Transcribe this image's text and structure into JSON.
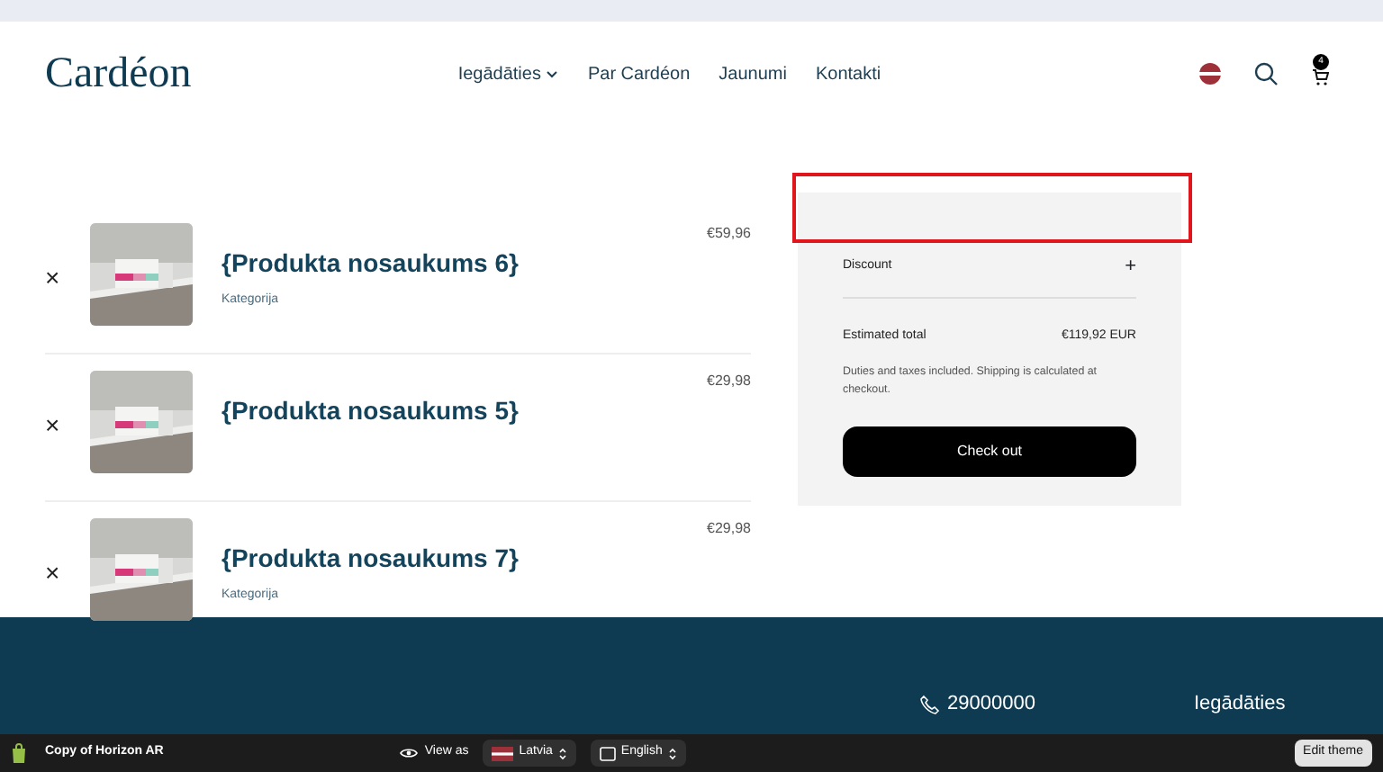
{
  "header": {
    "logo": "Cardéon",
    "nav": [
      {
        "label": "Iegādāties",
        "dropdown": true
      },
      {
        "label": "Par Cardéon",
        "dropdown": false
      },
      {
        "label": "Jaunumi",
        "dropdown": false
      },
      {
        "label": "Kontakti",
        "dropdown": false
      }
    ],
    "cart_count": "4"
  },
  "cart_items": [
    {
      "remove": "×",
      "name": "{Produkta nosaukums 6}",
      "category": "Kategorija",
      "price": "€59,96"
    },
    {
      "remove": "×",
      "name": "{Produkta nosaukums 5}",
      "price": "€29,98"
    },
    {
      "remove": "×",
      "name": "{Produkta nosaukums 7}",
      "category": "Kategorija",
      "price": "€29,98"
    }
  ],
  "summary": {
    "highlighted": true,
    "discount_label": "Discount",
    "discount_toggle": "+",
    "total_label": "Estimated total",
    "total_value": "€119,92 EUR",
    "note": "Duties and taxes included. Shipping is calculated at checkout.",
    "checkout": "Check out"
  },
  "footer": {
    "phone": "29000000",
    "link": "Iegādāties"
  },
  "editor_bar": {
    "theme_name": "Copy of Horizon AR",
    "view_as": "View as",
    "country": "Latvia",
    "language": "English",
    "edit": "Edit theme"
  }
}
